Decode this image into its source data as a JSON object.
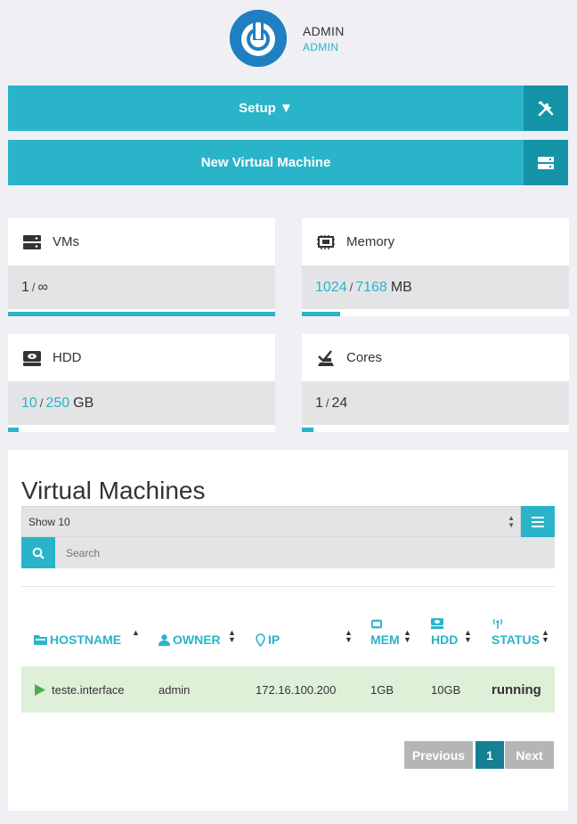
{
  "header": {
    "user_name": "ADMIN",
    "user_role": "ADMIN",
    "logo_icon": "power-logo-icon"
  },
  "buttons": {
    "setup_label": "Setup ▼",
    "setup_icon": "tools-icon",
    "new_vm_label": "New Virtual Machine",
    "new_vm_icon": "server-icon"
  },
  "stats": {
    "vms": {
      "label": "VMs",
      "icon": "server-icon",
      "used": "1",
      "sep": "/",
      "total": "∞",
      "fraction": 1.0
    },
    "memory": {
      "label": "Memory",
      "icon": "memory-chip-icon",
      "used": "1024",
      "sep": "/",
      "total": "7168",
      "unit": "MB",
      "fraction": 0.143
    },
    "hdd": {
      "label": "HDD",
      "icon": "hard-drive-icon",
      "used": "10",
      "sep": "/",
      "total": "250",
      "unit": "GB",
      "fraction": 0.04
    },
    "cores": {
      "label": "Cores",
      "icon": "cpu-core-icon",
      "used": "1",
      "sep": "/",
      "total": "24",
      "fraction": 0.042
    }
  },
  "vm_panel": {
    "title": "Virtual Machines",
    "show_select": "Show 10",
    "search_placeholder": "Search",
    "columns": [
      "HOSTNAME",
      "OWNER",
      "IP",
      "MEM",
      "HDD",
      "STATUS"
    ],
    "rows": [
      {
        "hostname": "teste.interface",
        "owner": "admin",
        "ip": "172.16.100.200",
        "mem": "1GB",
        "hdd": "10GB",
        "status": "running"
      }
    ],
    "pagination": {
      "previous": "Previous",
      "current": "1",
      "next": "Next"
    }
  },
  "colors": {
    "accent": "#2ab4c9",
    "accent_dark": "#1593a7",
    "row_running": "#dff0d8",
    "page_bg": "#efeff4"
  }
}
